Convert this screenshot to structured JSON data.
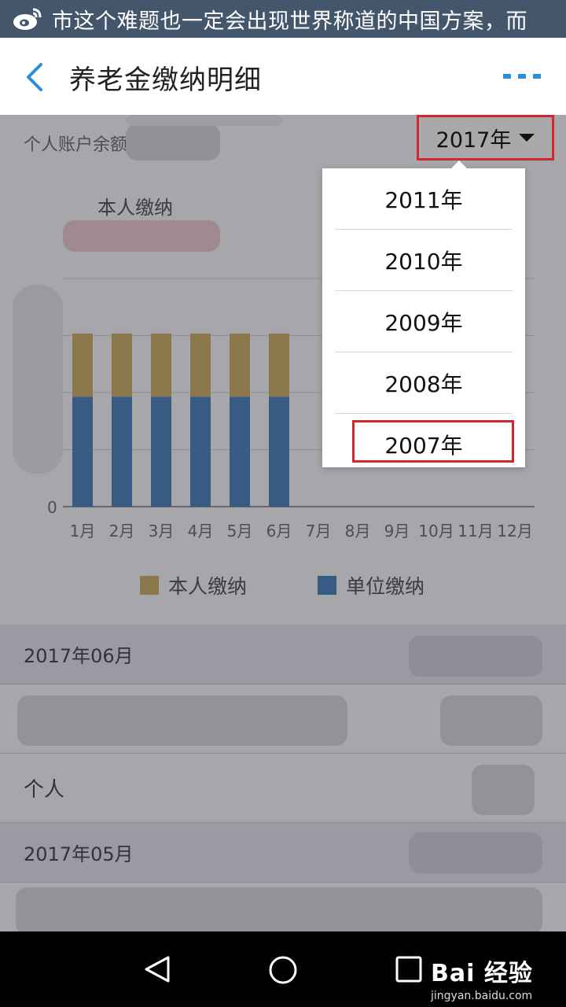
{
  "status_banner": {
    "text": "市这个难题也一定会出现世界称道的中国方案，而"
  },
  "header": {
    "title": "养老金缴纳明细"
  },
  "balance": {
    "label": "个人账户余额"
  },
  "year_selector": {
    "selected": "2017年"
  },
  "dropdown": {
    "options": [
      "2011年",
      "2010年",
      "2009年",
      "2008年",
      "2007年"
    ],
    "highlighted": "2007年"
  },
  "chart_title": "本人缴纳",
  "chart_data": {
    "type": "bar",
    "stacked": true,
    "categories": [
      "1月",
      "2月",
      "3月",
      "4月",
      "5月",
      "6月",
      "7月",
      "8月",
      "9月",
      "10月",
      "11月",
      "12月"
    ],
    "y_tick_label": "0",
    "series": [
      {
        "name": "单位缴纳",
        "color": "#2b6fb0",
        "values": [
          134,
          134,
          134,
          134,
          134,
          134,
          0,
          0,
          0,
          0,
          0,
          0
        ]
      },
      {
        "name": "本人缴纳",
        "color": "#c9a54a",
        "values": [
          77,
          77,
          77,
          77,
          77,
          77,
          0,
          0,
          0,
          0,
          0,
          0
        ]
      }
    ],
    "legend": [
      "本人缴纳",
      "单位缴纳"
    ],
    "grid": true,
    "legend_position": "bottom"
  },
  "records": {
    "headers": [
      "2017年06月",
      "2017年05月"
    ],
    "row_label": "个人"
  },
  "watermark": {
    "brand": "Bai 经验",
    "url": "jingyan.baidu.com"
  },
  "colors": {
    "accent": "#2a8fd6",
    "highlight_border": "#d4262e",
    "status_bg": "#43566b"
  }
}
